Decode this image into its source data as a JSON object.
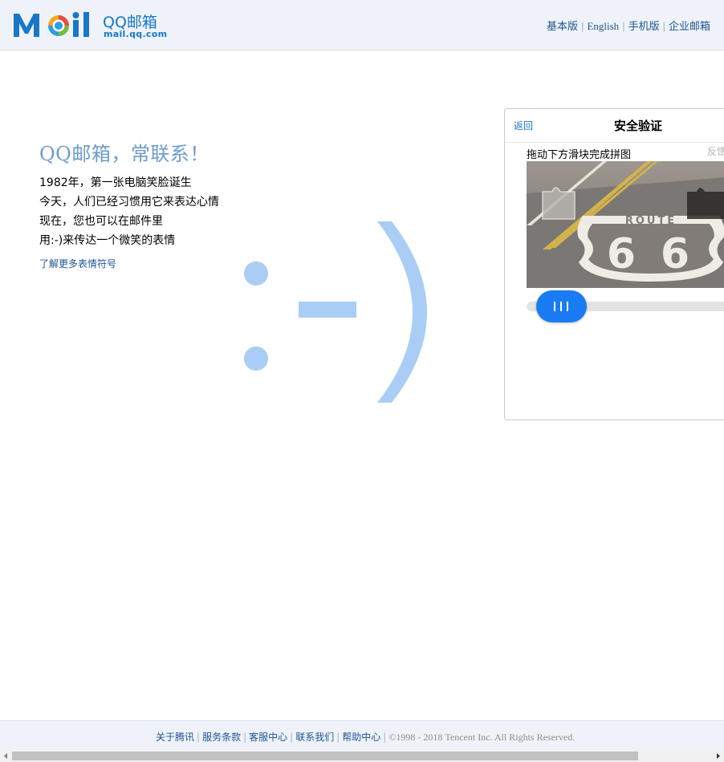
{
  "header": {
    "logo_cn": "QQ邮箱",
    "logo_en": "mail.qq.com",
    "links": [
      "基本版",
      "English",
      "手机版",
      "企业邮箱"
    ]
  },
  "intro": {
    "title": "QQ邮箱，常联系！",
    "lines": [
      "1982年，第一张电脑笑脸诞生",
      "今天，人们已经习惯用它来表达心情",
      "现在，您也可以在邮件里",
      "用:-)来传达一个微笑的表情"
    ],
    "link": "了解更多表情符号"
  },
  "captcha": {
    "back": "返回",
    "title": "安全验证",
    "instruction": "拖动下方滑块完成拼图",
    "feedback": "反馈",
    "image_alt": "ROUTE 66",
    "slider_position": 0
  },
  "footer": {
    "links": [
      "关于腾讯",
      "服务条款",
      "客服中心",
      "联系我们",
      "帮助中心"
    ],
    "copyright": "©1998 - 2018 Tencent Inc. All Rights Reserved."
  },
  "colors": {
    "brand_blue": "#1877c9",
    "link_blue": "#1e5494",
    "smiley_blue": "#a9cdf5",
    "slider_blue": "#1a7cf2",
    "header_bg": "#eff3f9"
  }
}
